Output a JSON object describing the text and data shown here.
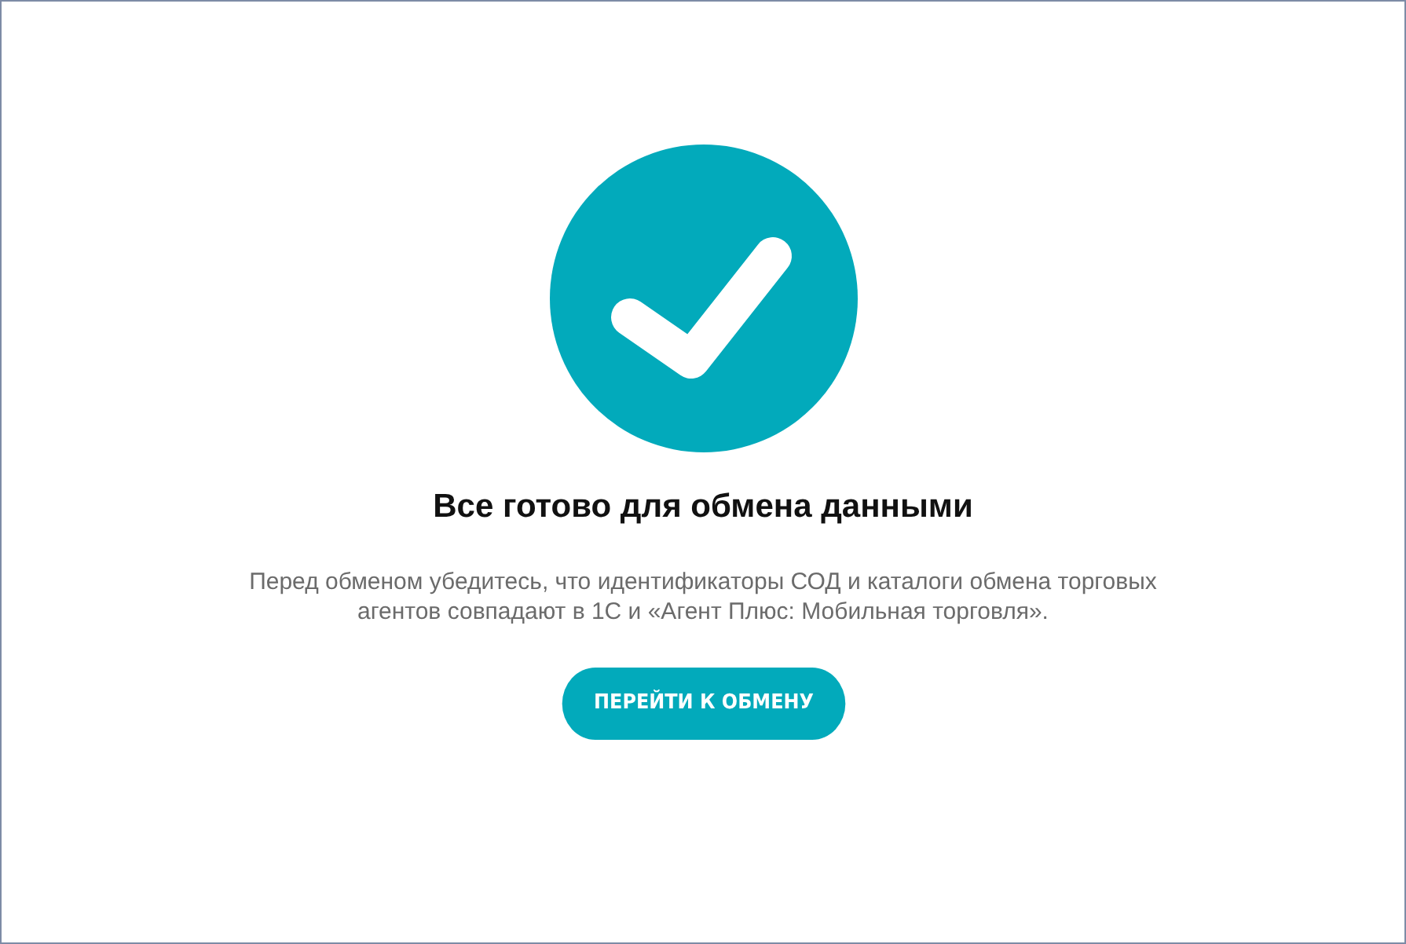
{
  "title": "Все готово для обмена данными",
  "message": "Перед обменом убедитесь, что идентификаторы СОД и каталоги обмена торговых агентов совпадают в 1С и «Агент Плюс: Мобильная торговля».",
  "button": {
    "label": "ПЕРЕЙТИ К ОБМЕНУ"
  }
}
